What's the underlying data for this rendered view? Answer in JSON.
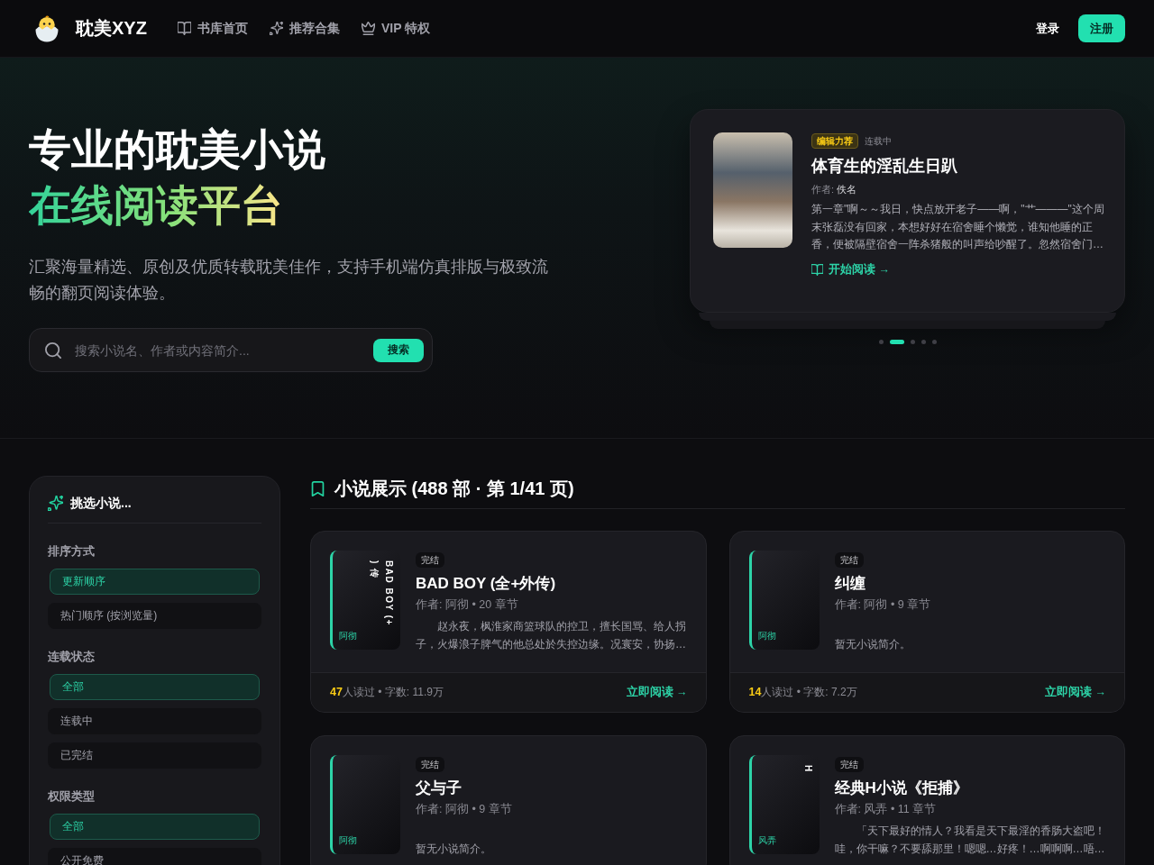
{
  "nav": {
    "brand": "耽美XYZ",
    "links": [
      {
        "kind": "book",
        "label": "书库首页"
      },
      {
        "kind": "sparkle",
        "label": "推荐合集"
      },
      {
        "kind": "crown",
        "label": "VIP 特权"
      }
    ],
    "login": "登录",
    "register": "注册"
  },
  "hero": {
    "title_line1": "专业的耽美小说",
    "title_line2": "在线阅读平台",
    "description": "汇聚海量精选、原创及优质转载耽美佳作，支持手机端仿真排版与极致流畅的翻页阅读体验。",
    "search": {
      "placeholder": "搜索小说名、作者或内容简介...",
      "button": "搜索"
    },
    "featured": {
      "badge": "编辑力荐",
      "status": "连载中",
      "title": "体育生的淫乱生日趴",
      "author_label": "作者: ",
      "author": "佚名",
      "excerpt": "第一章\"啊～～我日，快点放开老子——啊，\"艹———\"这个周末张磊没有回家，本想好好在宿舍睡个懒觉，谁知他睡的正香，便被隔壁宿舍一阵杀猪般的叫声给吵醒了。忽然宿舍门…",
      "link": "开始阅读 →"
    },
    "dots": [
      {
        "selected": false
      },
      {
        "selected": true
      },
      {
        "selected": false
      },
      {
        "selected": false
      },
      {
        "selected": false
      }
    ]
  },
  "filters": {
    "title": "挑选小说...",
    "groups": [
      {
        "label": "排序方式",
        "options": [
          {
            "label": "更新顺序",
            "selected": true
          },
          {
            "label": "热门顺序 (按浏览量)",
            "selected": false
          }
        ]
      },
      {
        "label": "连载状态",
        "options": [
          {
            "label": "全部",
            "selected": true
          },
          {
            "label": "连载中",
            "selected": false
          },
          {
            "label": "已完结",
            "selected": false
          }
        ]
      },
      {
        "label": "权限类型",
        "options": [
          {
            "label": "全部",
            "selected": true
          },
          {
            "label": "公开免费",
            "selected": false
          }
        ]
      }
    ]
  },
  "novels": {
    "heading": "小说展示 (488 部 · 第 1/41 页)",
    "items": [
      {
        "status": "完结",
        "title": "BAD BOY (全+外传)",
        "cover_title": "BAD BOY (+\n) 传",
        "cover_author": "阿彻",
        "meta": "作者: 阿彻 • 20 章节",
        "description": "　　赵永夜，枫淮家商篮球队的控卫，擅长国骂、给人拐子，火爆浪子脾气的他总处於失控边缘。况寰安，协扬…",
        "readers": "47",
        "stats": "人读过 • 字数: 11.9万",
        "link": "立即阅读 →"
      },
      {
        "status": "完结",
        "title": "纠缠",
        "cover_author": "阿彻",
        "meta": "作者: 阿彻 • 9 章节",
        "description": "暂无小说简介。",
        "readers": "14",
        "stats": "人读过 • 字数: 7.2万",
        "link": "立即阅读 →"
      },
      {
        "status": "完结",
        "title": "父与子",
        "cover_author": "阿彻",
        "meta": "作者: 阿彻 • 9 章节",
        "description": "暂无小说简介。"
      },
      {
        "status": "完结",
        "title": "经典H小说《拒捕》",
        "cover_title": "H",
        "cover_author": "风弄",
        "meta": "作者: 风弄 • 11 章节",
        "description": "　　「天下最好的情人？我看是天下最淫的香肠大盗吧！哇，你干嘛？不要舔那里！嗯嗯…好疼！…啊啊啊…唔…"
      }
    ]
  }
}
